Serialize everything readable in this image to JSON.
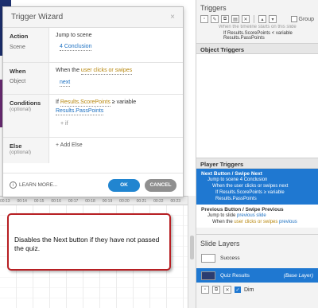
{
  "dialog": {
    "title": "Trigger Wizard",
    "close": "×",
    "action_label": "Action",
    "action_value": "Jump to scene",
    "scene_label": "Scene",
    "scene_value": "4 Conclusion",
    "when_label": "When",
    "when_prefix": "When the ",
    "when_value": "user clicks or swipes",
    "object_label": "Object",
    "object_value": "next",
    "conditions_label": "Conditions",
    "optional": "(optional)",
    "cond_if": "If ",
    "cond_var": "Results.ScorePoints",
    "cond_op": " ≥ variable",
    "cond_rhs": "Results.PassPoints",
    "add_if": "+ if",
    "else_label": "Else",
    "add_else": "+ Add Else",
    "learn_more": "LEARN MORE...",
    "ok": "OK",
    "cancel": "CANCEL"
  },
  "ruler_ticks": [
    "00:13",
    "00:14",
    "00:15",
    "00:16",
    "00:17",
    "00:18",
    "00:19",
    "00:20",
    "00:21",
    "00:22",
    "00:23"
  ],
  "callout": "Disables the Next button if they have not passed the quiz.",
  "panel": {
    "triggers_title": "Triggers",
    "group_label": "Group",
    "trig_line1": "When the timeline starts on this slide",
    "trig_line2": "If Results.ScorePoints < variable Results.PassPoints",
    "object_triggers": "Object Triggers",
    "player_triggers": "Player Triggers",
    "next_title": "Next Button / Swipe Next",
    "next_l1": "Jump to scene 4 Conclusion",
    "next_l2": "When the user clicks or swipes next",
    "next_l3": "If Results.ScorePoints ≥ variable Results.PassPoints",
    "prev_title": "Previous Button / Swipe Previous",
    "prev_l1_a": "Jump to slide ",
    "prev_l1_b": "previous slide",
    "prev_l2_a": "When the ",
    "prev_l2_b": "user clicks or swipes",
    "prev_l2_c": " previous",
    "slide_layers": "Slide Layers",
    "layer1": "Success",
    "layer2": "Quiz Results",
    "layer2_base": "(Base Layer)",
    "dim": "Dim"
  }
}
